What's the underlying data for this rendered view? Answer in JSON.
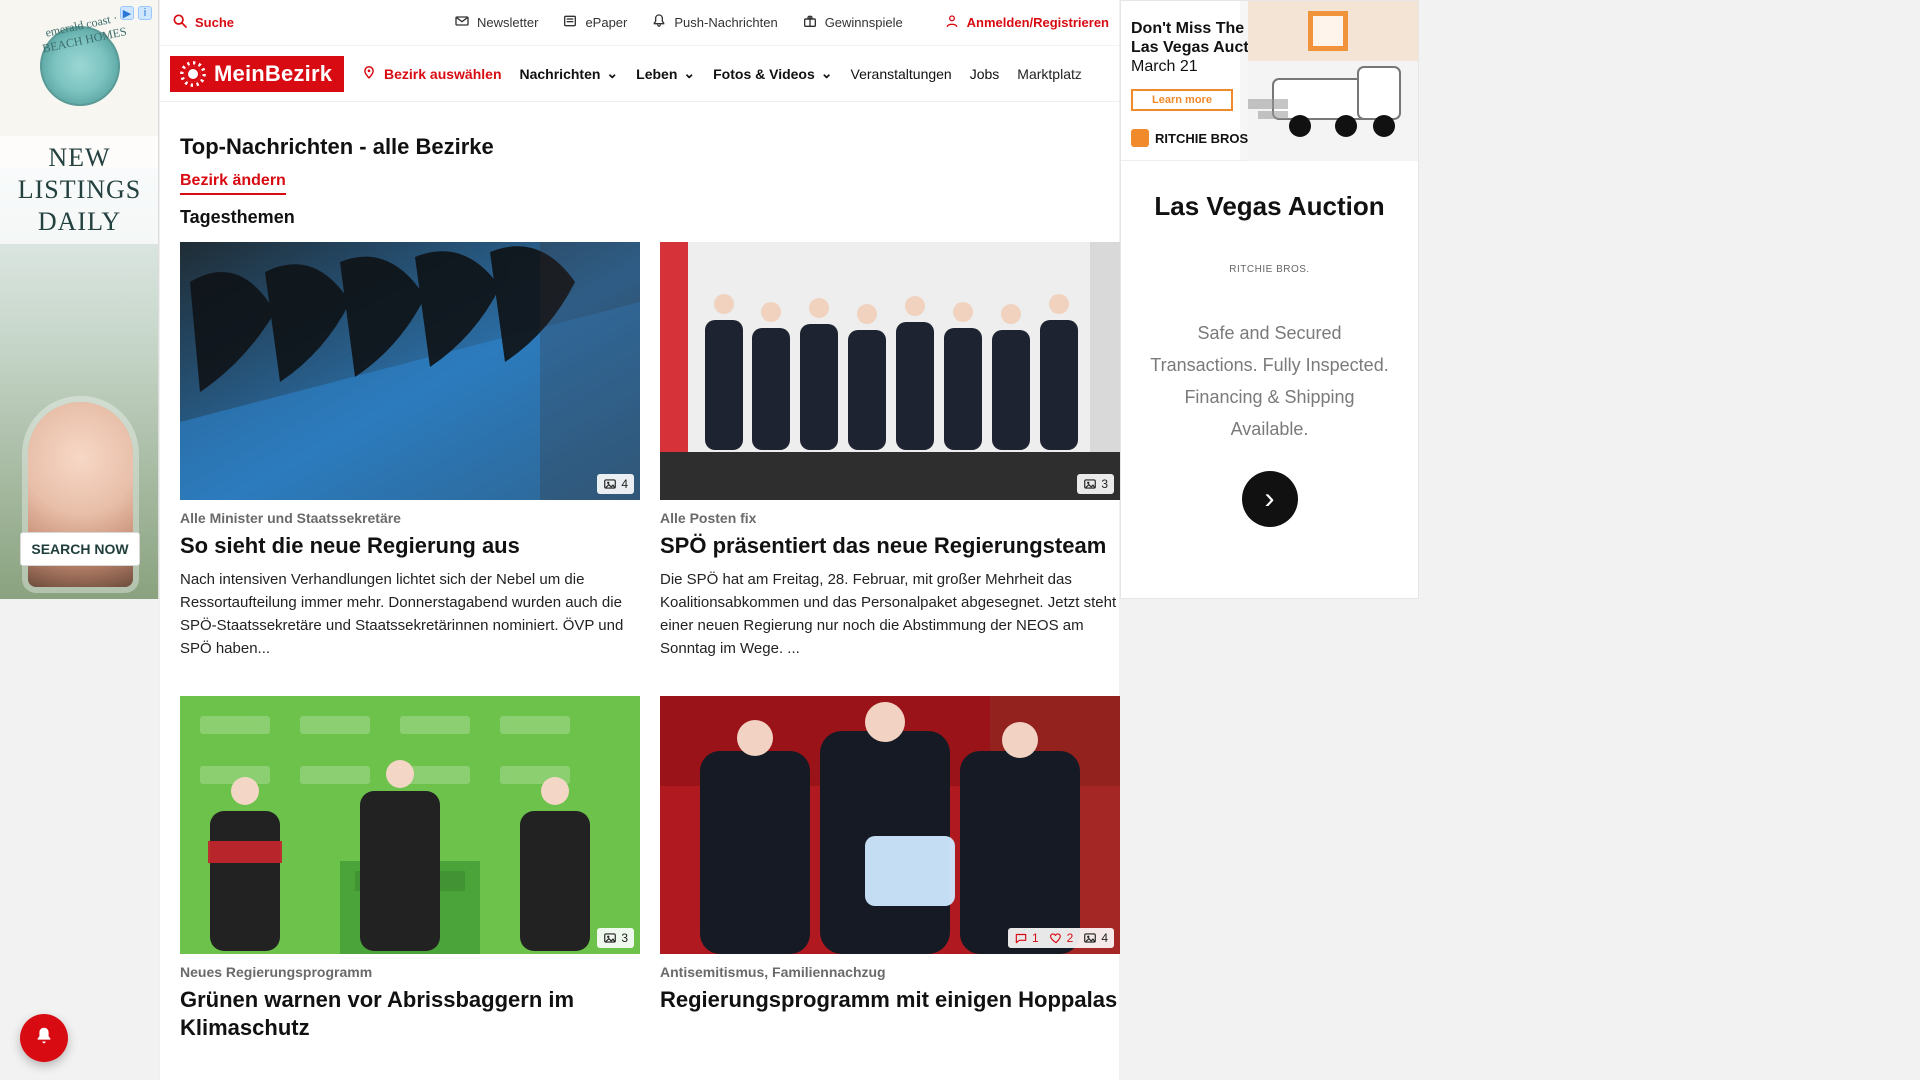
{
  "colors": {
    "accent": "#d90b12",
    "text": "#111111",
    "muted": "#6b6b6b",
    "background": "#f2f2f2"
  },
  "utility": {
    "search": "Suche",
    "newsletter": "Newsletter",
    "epaper": "ePaper",
    "push": "Push-Nachrichten",
    "gewinnspiele": "Gewinnspiele",
    "login": "Anmelden/Registrieren"
  },
  "nav": {
    "brand": "MeinBezirk",
    "district_select": "Bezirk auswählen",
    "items": [
      {
        "label": "Nachrichten",
        "has_dropdown": true
      },
      {
        "label": "Leben",
        "has_dropdown": true
      },
      {
        "label": "Fotos & Videos",
        "has_dropdown": true
      },
      {
        "label": "Veranstaltungen",
        "has_dropdown": false
      },
      {
        "label": "Jobs",
        "has_dropdown": false
      },
      {
        "label": "Marktplatz",
        "has_dropdown": false
      }
    ]
  },
  "page": {
    "title": "Top-Nachrichten - alle Bezirke",
    "change_district": "Bezirk ändern",
    "section": "Tagesthemen"
  },
  "articles": [
    {
      "kicker": "Alle Minister und Staatssekretäre",
      "title": "So sieht die neue Regierung aus",
      "excerpt": "Nach intensiven Verhandlungen lichtet sich der Nebel um die Ressortaufteilung immer mehr. Donnerstagabend wurden auch die SPÖ-Staatssekretäre und Staatssekretärinnen nominiert. ÖVP und SPÖ haben...",
      "meta": {
        "photos": "4"
      }
    },
    {
      "kicker": "Alle Posten fix",
      "title": "SPÖ präsentiert das neue Regierungsteam",
      "excerpt": "Die SPÖ hat am Freitag, 28. Februar, mit großer Mehrheit das Koalitionsabkommen und das Personalpaket abgesegnet. Jetzt steht einer neuen Regierung nur noch die Abstimmung der NEOS am Sonntag im Wege. ...",
      "meta": {
        "photos": "3"
      }
    },
    {
      "kicker": "Neues Regierungsprogramm",
      "title": "Grünen warnen vor Abrissbaggern im Klimaschutz",
      "excerpt": "",
      "meta": {
        "photos": "3"
      }
    },
    {
      "kicker": "Antisemitismus, Familiennachzug",
      "title": "Regierungsprogramm mit einigen Hoppalas",
      "excerpt": "",
      "meta": {
        "comments": "1",
        "likes": "2",
        "photos": "4"
      }
    }
  ],
  "ads": {
    "left": {
      "brand_line": "emerald coast · BEACH HOMES",
      "headline": "NEW LISTINGS DAILY",
      "cta": "SEARCH NOW"
    },
    "right": {
      "top_line1": "Don't Miss The",
      "top_line2": "Las Vegas Auction",
      "top_line3": "March 21",
      "learn_more": "Learn more",
      "brand": "RITCHIE BROS.",
      "big_title": "Las Vegas Auction",
      "small_logo": "RITCHIE BROS.",
      "description": "Safe and Secured Transactions. Fully Inspected. Financing & Shipping Available."
    }
  }
}
